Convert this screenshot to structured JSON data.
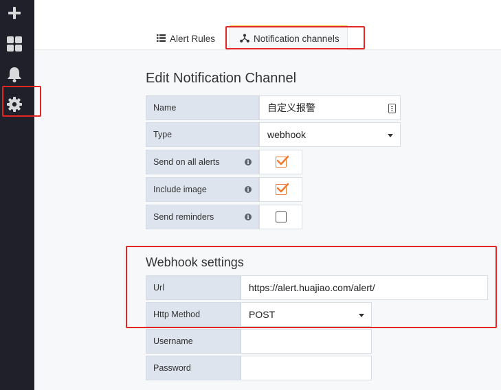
{
  "sidebar": {
    "items": [
      {
        "icon": "plus-icon"
      },
      {
        "icon": "dashboards-icon"
      },
      {
        "icon": "bell-icon"
      },
      {
        "icon": "gear-icon"
      }
    ]
  },
  "tabs": {
    "alert_rules": {
      "label": "Alert Rules",
      "icon": "list-icon"
    },
    "notification_channels": {
      "label": "Notification channels",
      "icon": "share-nodes-icon"
    }
  },
  "edit_channel": {
    "title": "Edit Notification Channel",
    "name": {
      "label": "Name",
      "value": "自定义报警"
    },
    "type": {
      "label": "Type",
      "value": "webhook"
    },
    "send_on_all_alerts": {
      "label": "Send on all alerts",
      "checked": true
    },
    "include_image": {
      "label": "Include image",
      "checked": true
    },
    "send_reminders": {
      "label": "Send reminders",
      "checked": false
    }
  },
  "webhook": {
    "title": "Webhook settings",
    "url": {
      "label": "Url",
      "value": "https://alert.huajiao.com/alert/"
    },
    "http_method": {
      "label": "Http Method",
      "value": "POST"
    },
    "username": {
      "label": "Username",
      "value": ""
    },
    "password": {
      "label": "Password",
      "value": ""
    }
  },
  "colors": {
    "sidebar_bg": "#1f2029",
    "annotation_red": "#e52521",
    "check_orange": "#ef7a2f",
    "active_tab_accent": "#f5c342",
    "label_bg": "#dde4ed"
  }
}
